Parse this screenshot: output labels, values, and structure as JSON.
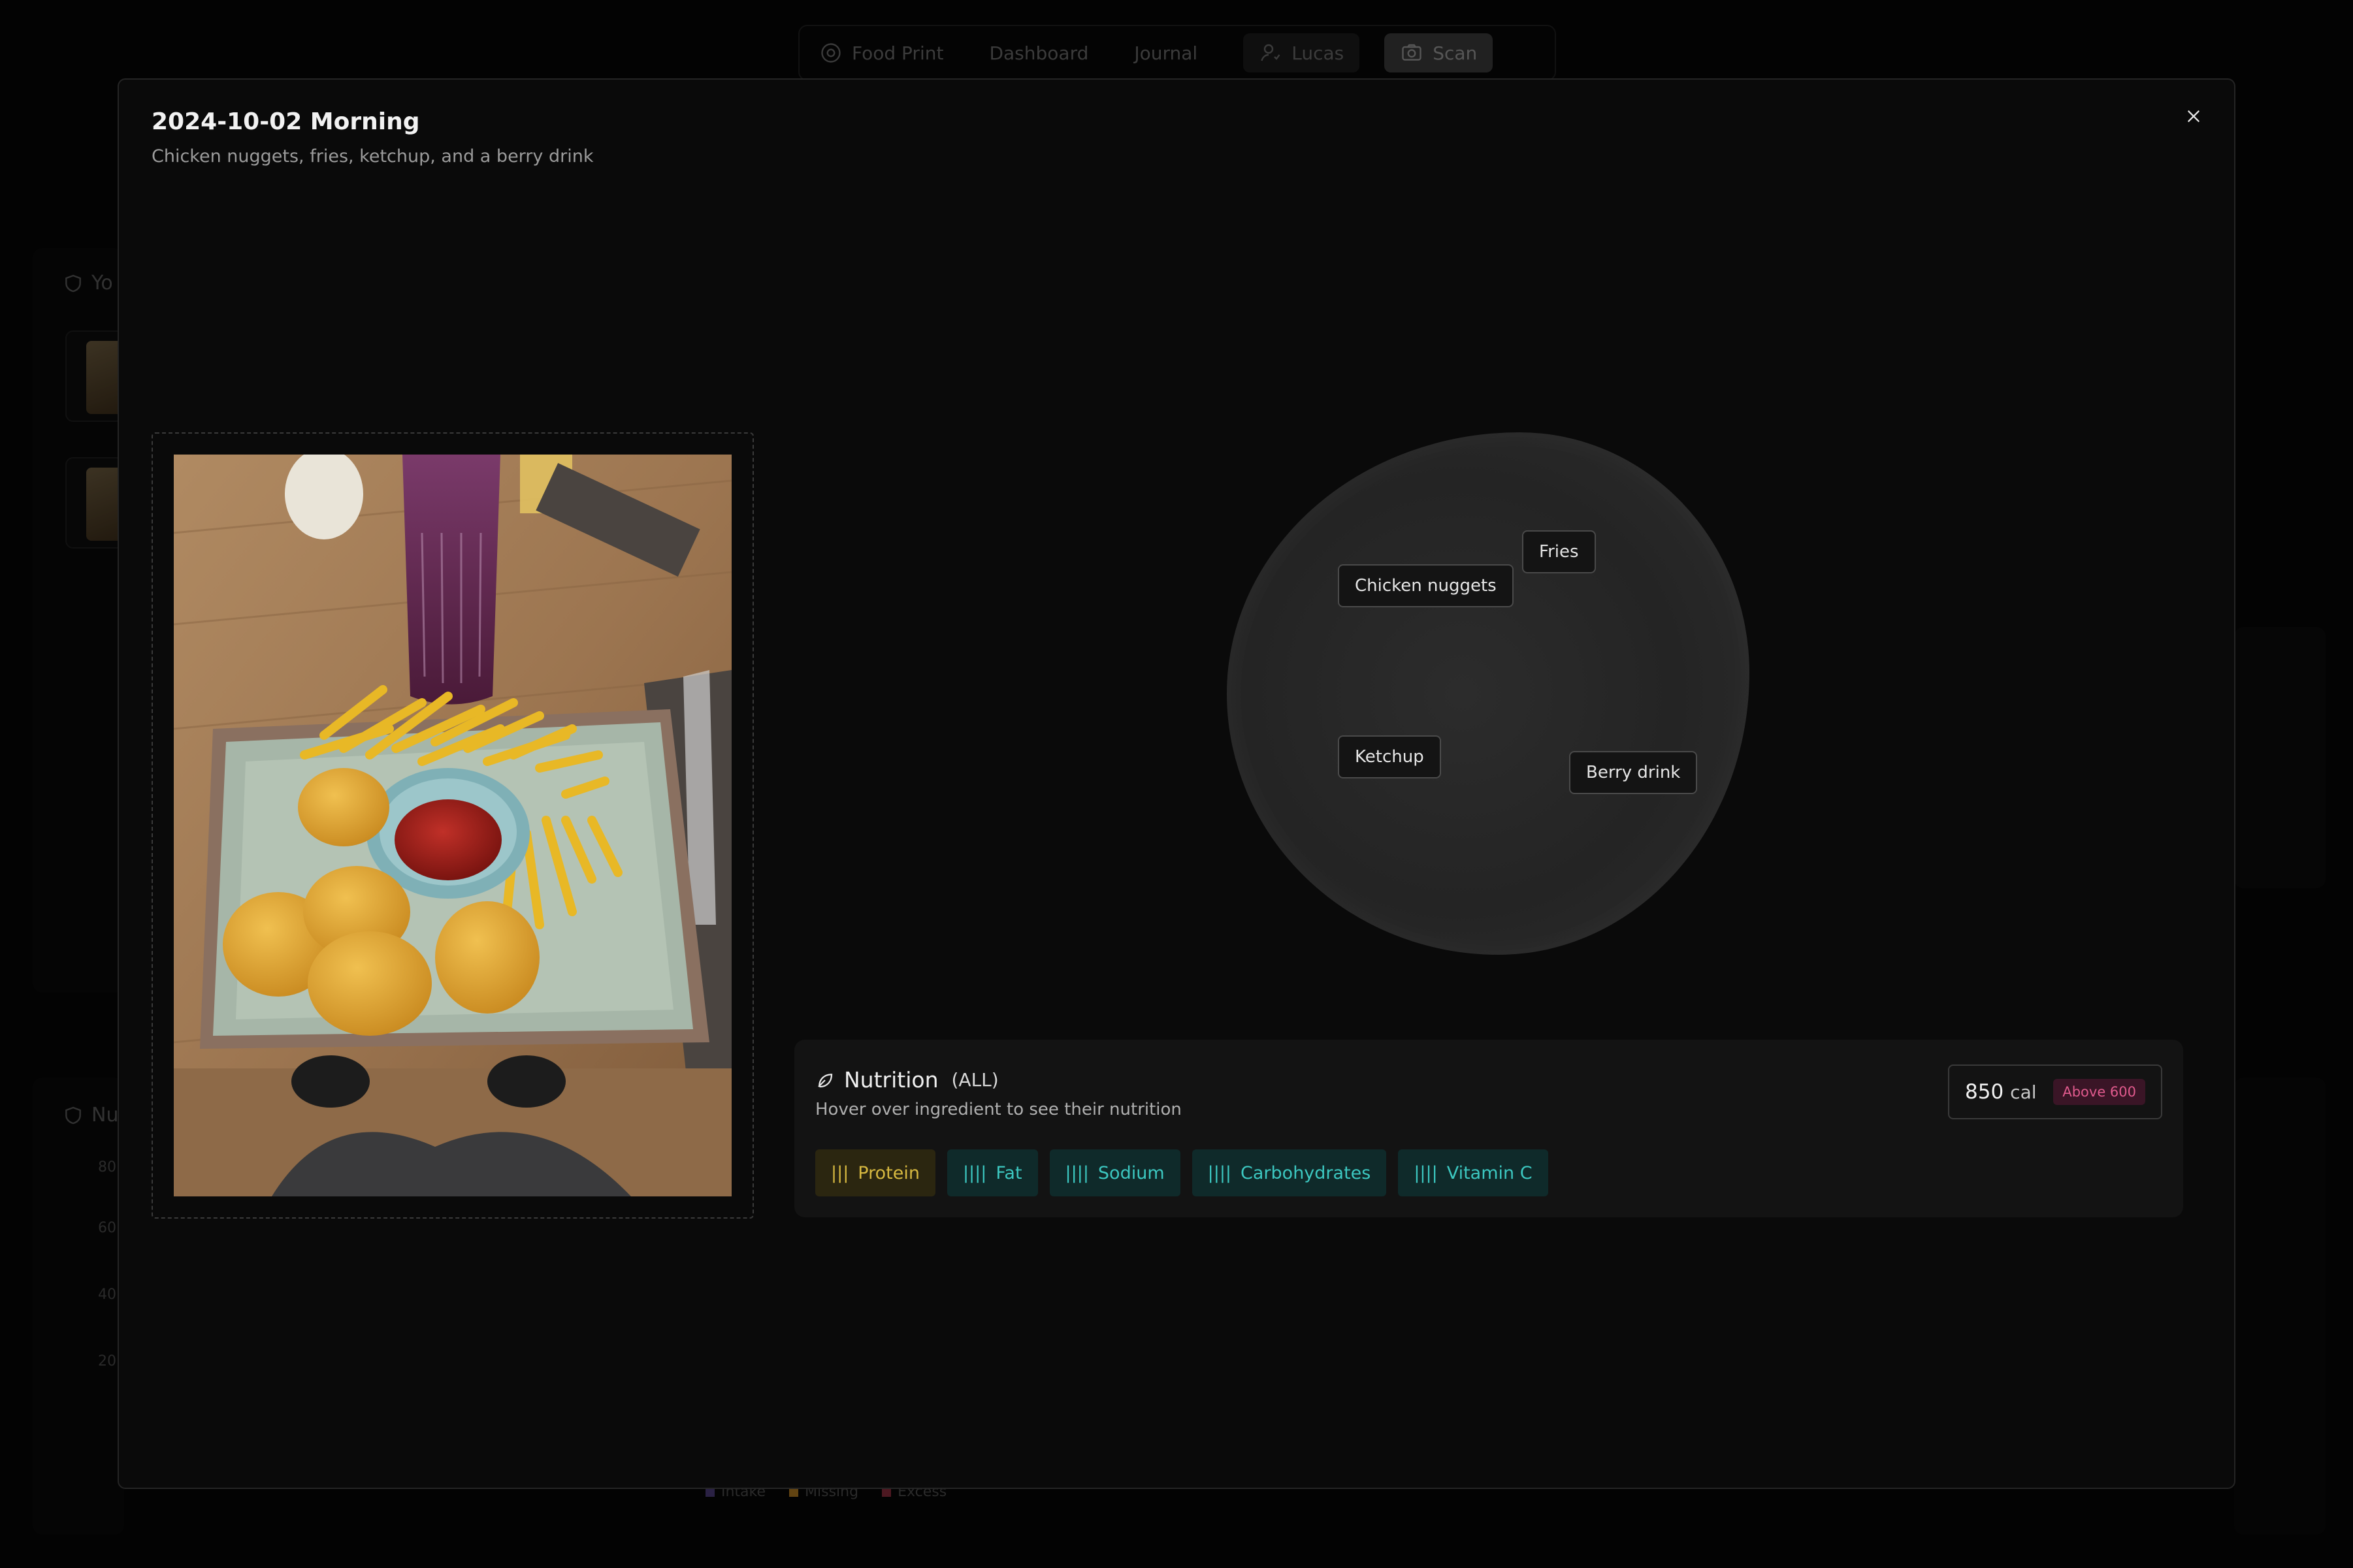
{
  "nav": {
    "brand": "Food Print",
    "items": [
      "Dashboard",
      "Journal"
    ],
    "user": "Lucas",
    "scan": "Scan"
  },
  "background": {
    "section1_heading": "Yo",
    "section2_heading": "Nu",
    "ticks": [
      "80",
      "60",
      "40",
      "20"
    ],
    "legend": [
      {
        "label": "Intake",
        "color": "#4a3a7a"
      },
      {
        "label": "Missing",
        "color": "#b07a20"
      },
      {
        "label": "Excess",
        "color": "#8a2a3a"
      }
    ]
  },
  "modal": {
    "title": "2024-10-02 Morning",
    "subtitle": "Chicken nuggets, fries, ketchup, and a berry drink",
    "ingredients": [
      "Chicken nuggets",
      "Fries",
      "Ketchup",
      "Berry drink"
    ],
    "nutrition": {
      "title": "Nutrition",
      "scope": "(ALL)",
      "hint": "Hover over ingredient to see their nutrition",
      "calories": "850",
      "calories_unit": "cal",
      "badge": "Above 600",
      "nutrients": [
        {
          "label": "Protein",
          "bars": "|||",
          "tone": "gold"
        },
        {
          "label": "Fat",
          "bars": "||||",
          "tone": "teal"
        },
        {
          "label": "Sodium",
          "bars": "||||",
          "tone": "teal"
        },
        {
          "label": "Carbohydrates",
          "bars": "||||",
          "tone": "teal"
        },
        {
          "label": "Vitamin C",
          "bars": "||||",
          "tone": "teal"
        }
      ]
    }
  },
  "colors": {
    "accent_teal": "#3cc7c0",
    "accent_gold": "#d6b840",
    "badge_pink": "#e05a8d"
  }
}
